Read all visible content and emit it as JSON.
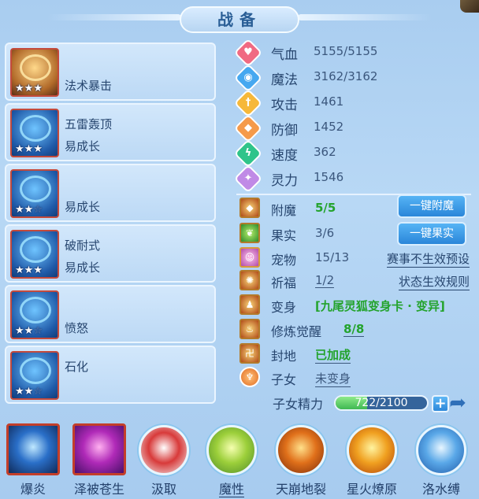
{
  "title": "战备",
  "cards": [
    {
      "lines": [
        "",
        "法术暴击"
      ],
      "stars": 3,
      "color": "gold"
    },
    {
      "lines": [
        "五雷轰顶",
        "易成长"
      ],
      "stars": 3,
      "color": "blue"
    },
    {
      "lines": [
        "",
        "易成长"
      ],
      "stars": 2,
      "color": "blue"
    },
    {
      "lines": [
        "破耐式",
        "易成长"
      ],
      "stars": 3,
      "color": "blue"
    },
    {
      "lines": [
        "",
        "愤怒"
      ],
      "stars": 2,
      "color": "blue"
    },
    {
      "lines": [
        "石化",
        ""
      ],
      "stars": 2,
      "color": "blue"
    }
  ],
  "stats": [
    {
      "label": "气血",
      "value": "5155/5155",
      "icon": "heart-icon",
      "color": "#f06a82"
    },
    {
      "label": "魔法",
      "value": "3162/3162",
      "icon": "mana-icon",
      "color": "#46a8f0"
    },
    {
      "label": "攻击",
      "value": "1461",
      "icon": "sword-icon",
      "color": "#f6b83a"
    },
    {
      "label": "防御",
      "value": "1452",
      "icon": "shield-icon",
      "color": "#f59a4a"
    },
    {
      "label": "速度",
      "value": "362",
      "icon": "lightning-icon",
      "color": "#2fc48a"
    },
    {
      "label": "灵力",
      "value": "1546",
      "icon": "spirit-icon",
      "color": "#c08ae6"
    }
  ],
  "features": {
    "enchant": {
      "label": "附魔",
      "value": "5/5",
      "button": "一键附魔"
    },
    "fruit": {
      "label": "果实",
      "value": "3/6",
      "button": "一键果实"
    },
    "pet": {
      "label": "宠物",
      "value": "15/13",
      "link": "赛事不生效预设"
    },
    "blessing": {
      "label": "祈福",
      "value": "1/2",
      "link": "状态生效规则"
    },
    "transform": {
      "label": "变身",
      "value": "[九尾灵狐变身卡 · 变异]"
    },
    "cultivation": {
      "label": "修炼觉醒",
      "value": "8/8"
    },
    "fengdi": {
      "label": "封地",
      "value": "已加成"
    },
    "child": {
      "label": "子女",
      "value": "未变身"
    }
  },
  "energy": {
    "label": "子女精力",
    "text": "722/2100",
    "current": 722,
    "max": 2100
  },
  "skills": [
    {
      "name": "爆炎",
      "style": "square",
      "grad": [
        "#bfe8ff",
        "#2a6fc8",
        "#0f2a5a"
      ],
      "underline": false
    },
    {
      "name": "泽被苍生",
      "style": "square",
      "grad": [
        "#ffb0f0",
        "#b02ab8",
        "#4a0f6a"
      ],
      "underline": false
    },
    {
      "name": "汲取",
      "style": "circle",
      "grad": [
        "#ffffff",
        "#d83a3a",
        "#f2f2f2"
      ],
      "underline": false
    },
    {
      "name": "魔性",
      "style": "circle",
      "grad": [
        "#f6ffb0",
        "#9ccf3a",
        "#4e8a2a"
      ],
      "underline": true
    },
    {
      "name": "天崩地裂",
      "style": "circle",
      "grad": [
        "#ffe08a",
        "#e0701a",
        "#7a2a0a"
      ],
      "underline": false
    },
    {
      "name": "星火燎原",
      "style": "circle",
      "grad": [
        "#fff4a0",
        "#f0a020",
        "#b0400a"
      ],
      "underline": false
    },
    {
      "name": "洛水缚",
      "style": "circle",
      "grad": [
        "#e8f6ff",
        "#5aa8e8",
        "#1f5aa8"
      ],
      "underline": false
    }
  ]
}
